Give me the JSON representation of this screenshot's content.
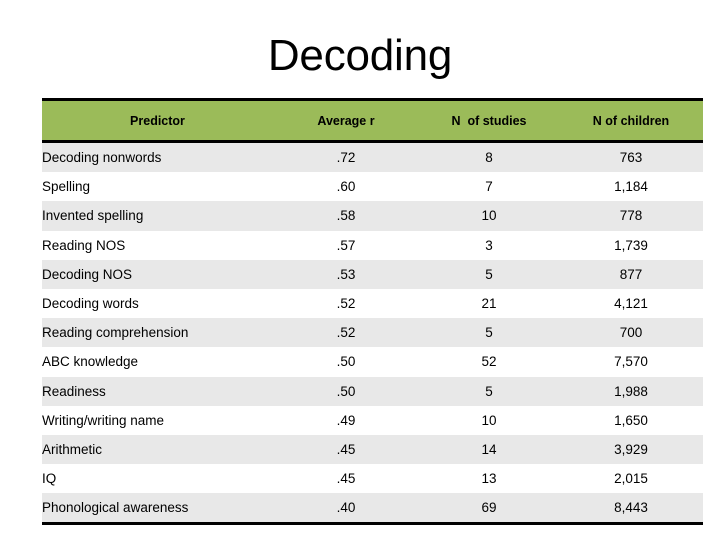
{
  "slide": {
    "title": "Decoding",
    "background_color": "#ffffff"
  },
  "table": {
    "header_fill": "#9bbb59",
    "row_shaded_fill": "#e8e8e8",
    "row_plain_fill": "#ffffff",
    "border_color": "#000000",
    "columns": [
      {
        "key": "predictor",
        "label": "Predictor",
        "align": "center"
      },
      {
        "key": "average_r",
        "label": "Average r",
        "align": "center"
      },
      {
        "key": "n_studies",
        "label": "N  of studies",
        "align": "center"
      },
      {
        "key": "n_children",
        "label": "N of children",
        "align": "center"
      }
    ],
    "rows": [
      {
        "predictor": "Decoding nonwords",
        "average_r": ".72",
        "n_studies": "8",
        "n_children": "763"
      },
      {
        "predictor": "Spelling",
        "average_r": ".60",
        "n_studies": "7",
        "n_children": "1,184"
      },
      {
        "predictor": "Invented spelling",
        "average_r": ".58",
        "n_studies": "10",
        "n_children": "778"
      },
      {
        "predictor": "Reading NOS",
        "average_r": ".57",
        "n_studies": "3",
        "n_children": "1,739"
      },
      {
        "predictor": "Decoding NOS",
        "average_r": ".53",
        "n_studies": "5",
        "n_children": "877"
      },
      {
        "predictor": "Decoding words",
        "average_r": ".52",
        "n_studies": "21",
        "n_children": "4,121"
      },
      {
        "predictor": "Reading comprehension",
        "average_r": ".52",
        "n_studies": "5",
        "n_children": "700"
      },
      {
        "predictor": "ABC knowledge",
        "average_r": ".50",
        "n_studies": "52",
        "n_children": "7,570"
      },
      {
        "predictor": "Readiness",
        "average_r": ".50",
        "n_studies": "5",
        "n_children": "1,988"
      },
      {
        "predictor": "Writing/writing name",
        "average_r": ".49",
        "n_studies": "10",
        "n_children": "1,650"
      },
      {
        "predictor": "Arithmetic",
        "average_r": ".45",
        "n_studies": "14",
        "n_children": "3,929"
      },
      {
        "predictor": "IQ",
        "average_r": ".45",
        "n_studies": "13",
        "n_children": "2,015"
      },
      {
        "predictor": "Phonological awareness",
        "average_r": ".40",
        "n_studies": "69",
        "n_children": "8,443"
      }
    ]
  }
}
